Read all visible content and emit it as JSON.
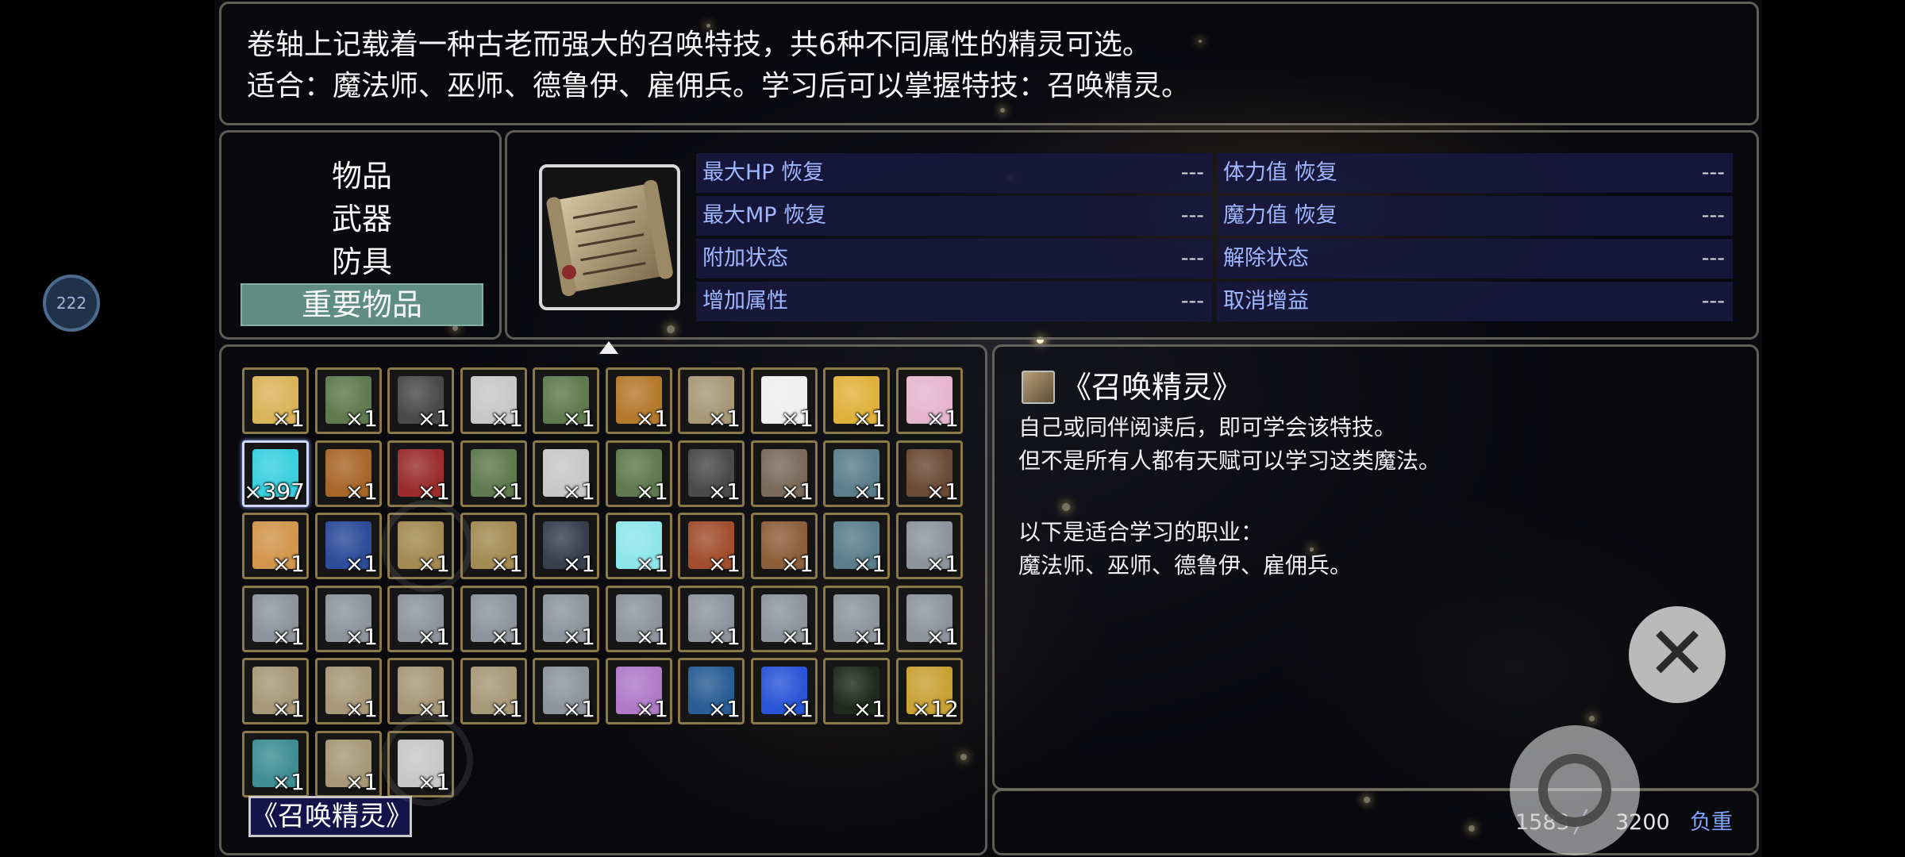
{
  "help": {
    "line1": "卷轴上记载着一种古老而强大的召唤特技，共6种不同属性的精灵可选。",
    "line2": "适合：魔法师、巫师、德鲁伊、雇佣兵。学习后可以掌握特技：召唤精灵。"
  },
  "categories": [
    {
      "label": "物品"
    },
    {
      "label": "武器"
    },
    {
      "label": "防具"
    },
    {
      "label": "重要物品",
      "selected": true
    }
  ],
  "effects": [
    {
      "label": "最大HP 恢复",
      "value": "---"
    },
    {
      "label": "体力值 恢复",
      "value": "---"
    },
    {
      "label": "最大MP 恢复",
      "value": "---"
    },
    {
      "label": "魔力值 恢复",
      "value": "---"
    },
    {
      "label": "附加状态",
      "value": "---"
    },
    {
      "label": "解除状态",
      "value": "---"
    },
    {
      "label": "增加属性",
      "value": "---"
    },
    {
      "label": "取消增益",
      "value": "---"
    }
  ],
  "inventory": {
    "items": [
      {
        "icon": "golden-bow-icon",
        "qty": "×1",
        "color": "#d9b45a"
      },
      {
        "icon": "scroll-icon",
        "qty": "×1",
        "color": "#5e7a4e"
      },
      {
        "icon": "spiked-mace-icon",
        "qty": "×1",
        "color": "#4a4a4a"
      },
      {
        "icon": "white-page-icon",
        "qty": "×1",
        "color": "#c8c8c8"
      },
      {
        "icon": "scroll-icon",
        "qty": "×1",
        "color": "#5e7a4e"
      },
      {
        "icon": "golden-relic-icon",
        "qty": "×1",
        "color": "#b5792d"
      },
      {
        "icon": "open-scroll-icon",
        "qty": "×1",
        "color": "#a89878"
      },
      {
        "icon": "candle-icon",
        "qty": "×1",
        "color": "#efefef"
      },
      {
        "icon": "golden-key-icon",
        "qty": "×1",
        "color": "#e0b23c"
      },
      {
        "icon": "crescent-moon-icon",
        "qty": "×1",
        "color": "#e6b6cf"
      },
      {
        "icon": "cyan-gem-icon",
        "qty": "×397",
        "color": "#3ad0e0",
        "selected": true
      },
      {
        "icon": "golden-armor-icon",
        "qty": "×1",
        "color": "#a8672a"
      },
      {
        "icon": "red-berries-icon",
        "qty": "×1",
        "color": "#9b2d2d"
      },
      {
        "icon": "scroll-icon",
        "qty": "×1",
        "color": "#5e7a4e"
      },
      {
        "icon": "white-page-icon",
        "qty": "×1",
        "color": "#c8c8c8"
      },
      {
        "icon": "scroll-icon",
        "qty": "×1",
        "color": "#5e7a4e"
      },
      {
        "icon": "spiked-mace-icon",
        "qty": "×1",
        "color": "#4a4a4a"
      },
      {
        "icon": "iron-key-icon",
        "qty": "×1",
        "color": "#7a6a5a"
      },
      {
        "icon": "blue-tome-icon",
        "qty": "×1",
        "color": "#5b7e8c"
      },
      {
        "icon": "brown-book-icon",
        "qty": "×1",
        "color": "#6b4a36"
      },
      {
        "icon": "rolled-scroll-icon",
        "qty": "×1",
        "color": "#d2954c"
      },
      {
        "icon": "blue-book-icon",
        "qty": "×1",
        "color": "#2c4c9a"
      },
      {
        "icon": "golden-book-icon",
        "qty": "×1",
        "color": "#a38b52"
      },
      {
        "icon": "golden-book-icon",
        "qty": "×1",
        "color": "#a38b52"
      },
      {
        "icon": "dark-book-icon",
        "qty": "×1",
        "color": "#38404e"
      },
      {
        "icon": "ice-cube-icon",
        "qty": "×1",
        "color": "#8fe6ea"
      },
      {
        "icon": "red-book-icon",
        "qty": "×1",
        "color": "#a24e2e"
      },
      {
        "icon": "brown-book-icon",
        "qty": "×1",
        "color": "#8d5f3a"
      },
      {
        "icon": "blue-tome-icon",
        "qty": "×1",
        "color": "#5b7e8c"
      },
      {
        "icon": "silver-tome-icon",
        "qty": "×1",
        "color": "#8e949e"
      },
      {
        "icon": "silver-tome-icon",
        "qty": "×1",
        "color": "#8e949e"
      },
      {
        "icon": "silver-tome-icon",
        "qty": "×1",
        "color": "#8e949e"
      },
      {
        "icon": "silver-tome-icon",
        "qty": "×1",
        "color": "#8e949e"
      },
      {
        "icon": "silver-tome-icon",
        "qty": "×1",
        "color": "#8e949e"
      },
      {
        "icon": "silver-tome-icon",
        "qty": "×1",
        "color": "#8e949e"
      },
      {
        "icon": "silver-tome-icon",
        "qty": "×1",
        "color": "#8e949e"
      },
      {
        "icon": "silver-tome-icon",
        "qty": "×1",
        "color": "#8e949e"
      },
      {
        "icon": "silver-tome-icon",
        "qty": "×1",
        "color": "#8e949e"
      },
      {
        "icon": "silver-tome-icon",
        "qty": "×1",
        "color": "#8e949e"
      },
      {
        "icon": "silver-tome-icon",
        "qty": "×1",
        "color": "#8e949e"
      },
      {
        "icon": "open-scroll-icon",
        "qty": "×1",
        "color": "#a89878"
      },
      {
        "icon": "open-scroll-icon",
        "qty": "×1",
        "color": "#a89878"
      },
      {
        "icon": "open-scroll-icon",
        "qty": "×1",
        "color": "#a89878"
      },
      {
        "icon": "open-scroll-icon",
        "qty": "×1",
        "color": "#a89878"
      },
      {
        "icon": "silver-tome-icon",
        "qty": "×1",
        "color": "#8e949e"
      },
      {
        "icon": "demon-mask-icon",
        "qty": "×1",
        "color": "#b07ac8"
      },
      {
        "icon": "blue-frame-icon",
        "qty": "×1",
        "color": "#2a5d95"
      },
      {
        "icon": "blue-crystal-icon",
        "qty": "×1",
        "color": "#2a55d8"
      },
      {
        "icon": "dark-orb-icon",
        "qty": "×1",
        "color": "#1f2a1c"
      },
      {
        "icon": "gold-coin-icon",
        "qty": "×12",
        "color": "#c9a135"
      },
      {
        "icon": "teal-artifact-icon",
        "qty": "×1",
        "color": "#3f8e94"
      },
      {
        "icon": "open-scroll-icon",
        "qty": "×1",
        "color": "#a89878"
      },
      {
        "icon": "white-page-icon",
        "qty": "×1",
        "color": "#c8c8c8"
      }
    ],
    "selected_name": "《召唤精灵》"
  },
  "description": {
    "title": "《召唤精灵》",
    "lines": [
      "自己或同伴阅读后，即可学会该特技。",
      "但不是所有人都有天赋可以学习这类魔法。",
      "",
      "以下是适合学习的职业：",
      "魔法师、巫师、德鲁伊、雇佣兵。"
    ]
  },
  "weight": {
    "current": "1583",
    "max": "3200",
    "label": "负重"
  },
  "badge": {
    "text": "222"
  },
  "close_icon": "close-icon",
  "action_icon": "ring-icon"
}
